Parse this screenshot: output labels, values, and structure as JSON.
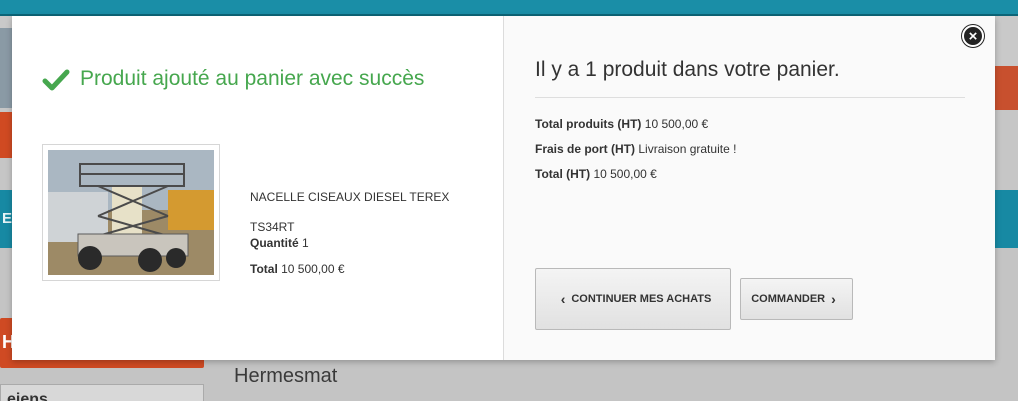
{
  "background": {
    "teal_letter": "E",
    "red_button_label": "Hu",
    "select_label": "eiens",
    "page_text": "Hermesmat"
  },
  "modal": {
    "success_message": "Produit ajouté au panier avec succès",
    "product": {
      "name": "NACELLE CISEAUX DIESEL TEREX TS34RT",
      "quantity_label": "Quantité",
      "quantity": "1",
      "total_label": "Total",
      "total": "10 500,00 €",
      "image_icon": "scissor-lift-photo"
    },
    "cart": {
      "heading": "Il y a 1 produit dans votre panier.",
      "products_label": "Total produits (HT)",
      "products_value": "10 500,00 €",
      "shipping_label": "Frais de port (HT)",
      "shipping_value": "Livraison gratuite !",
      "total_label": "Total (HT)",
      "total_value": "10 500,00 €"
    },
    "buttons": {
      "continue": "CONTINUER MES ACHATS",
      "order": "COMMANDER",
      "close_icon": "close-icon"
    }
  },
  "colors": {
    "success": "#46a74e",
    "teal": "#1789a3",
    "accent_red": "#cf4a23"
  }
}
